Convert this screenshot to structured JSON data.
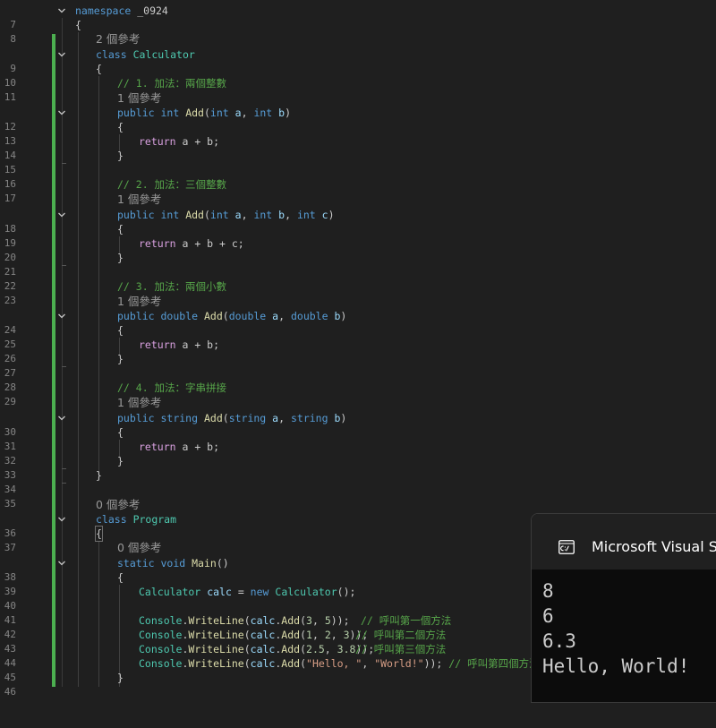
{
  "editor": {
    "line_numbers": [
      "7",
      "8",
      "9",
      "10",
      "11",
      "12",
      "13",
      "14",
      "15",
      "16",
      "17",
      "18",
      "19",
      "20",
      "21",
      "22",
      "23",
      "24",
      "25",
      "26",
      "27",
      "28",
      "29",
      "30",
      "31",
      "32",
      "33",
      "34",
      "35",
      "36",
      "37",
      "38",
      "39",
      "40",
      "41",
      "42",
      "43",
      "44",
      "45",
      "46"
    ],
    "code": {
      "l7_kw": "namespace",
      "l7_name": " _0924",
      "l8": "{",
      "l9_kw": "class",
      "l9_name": "Calculator",
      "l10": "{",
      "l11_cmt": "// 1. 加法：兩個整數",
      "l12_a": "public",
      "l12_b": "int",
      "l12_fn": "Add",
      "l12_c": "(",
      "l12_d": "int",
      "l12_e": "a",
      "l12_f": ", ",
      "l12_g": "int",
      "l12_h": "b",
      "l12_i": ")",
      "l13": "{",
      "l14_ret": "return",
      "l14_expr": " a + b;",
      "l15": "}",
      "l17_cmt": "// 2. 加法：三個整數",
      "l18_a": "public",
      "l18_b": "int",
      "l18_fn": "Add",
      "l18_c": "(",
      "l18_d": "int",
      "l18_e": "a",
      "l18_f": ", ",
      "l18_g": "int",
      "l18_h": "b",
      "l18_i": ", ",
      "l18_j": "int",
      "l18_k": "c",
      "l18_l": ")",
      "l19": "{",
      "l20_ret": "return",
      "l20_expr": " a + b + c;",
      "l21": "}",
      "l23_cmt": "// 3. 加法：兩個小數",
      "l24_a": "public",
      "l24_b": "double",
      "l24_fn": "Add",
      "l24_c": "(",
      "l24_d": "double",
      "l24_e": "a",
      "l24_f": ", ",
      "l24_g": "double",
      "l24_h": "b",
      "l24_i": ")",
      "l25": "{",
      "l26_ret": "return",
      "l26_expr": " a + b;",
      "l27": "}",
      "l29_cmt": "// 4. 加法：字串拼接",
      "l30_a": "public",
      "l30_b": "string",
      "l30_fn": "Add",
      "l30_c": "(",
      "l30_d": "string",
      "l30_e": "a",
      "l30_f": ", ",
      "l30_g": "string",
      "l30_h": "b",
      "l30_i": ")",
      "l31": "{",
      "l32_ret": "return",
      "l32_expr": " a + b;",
      "l33": "}",
      "l34": "}",
      "l36_kw": "class",
      "l36_name": "Program",
      "l37": "{",
      "l38_a": "static",
      "l38_b": "void",
      "l38_fn": "Main",
      "l38_c": "()",
      "l39": "{",
      "l40_type": "Calculator",
      "l40_var": "calc",
      "l40_eq": " = ",
      "l40_new": "new",
      "l40_type2": "Calculator",
      "l40_end": "();",
      "l42_cls": "Console",
      "l42_dot": ".",
      "l42_fn": "WriteLine",
      "l42_p": "(",
      "l42_var": "calc",
      "l42_dot2": ".",
      "l42_fn2": "Add",
      "l42_p2": "(",
      "l42_n1": "3",
      "l42_s": ", ",
      "l42_n2": "5",
      "l42_end": "));",
      "l42_cmt": "// 呼叫第一個方法",
      "l43_cls": "Console",
      "l43_dot": ".",
      "l43_fn": "WriteLine",
      "l43_p": "(",
      "l43_var": "calc",
      "l43_dot2": ".",
      "l43_fn2": "Add",
      "l43_p2": "(",
      "l43_n1": "1",
      "l43_s": ", ",
      "l43_n2": "2",
      "l43_s2": ", ",
      "l43_n3": "3",
      "l43_end": "));",
      "l43_cmt": "// 呼叫第二個方法",
      "l44_cls": "Console",
      "l44_dot": ".",
      "l44_fn": "WriteLine",
      "l44_p": "(",
      "l44_var": "calc",
      "l44_dot2": ".",
      "l44_fn2": "Add",
      "l44_p2": "(",
      "l44_n1": "2.5",
      "l44_s": ", ",
      "l44_n2": "3.8",
      "l44_end": "));",
      "l44_cmt": "// 呼叫第三個方法",
      "l45_cls": "Console",
      "l45_dot": ".",
      "l45_fn": "WriteLine",
      "l45_p": "(",
      "l45_var": "calc",
      "l45_dot2": ".",
      "l45_fn2": "Add",
      "l45_p2": "(",
      "l45_s1": "\"Hello, \"",
      "l45_s": ", ",
      "l45_s2": "\"World!\"",
      "l45_end": "));",
      "l45_cmt": "// 呼叫第四個方法",
      "l46": "}"
    },
    "code_lens": {
      "calculator": "2 個參考",
      "add_1": "1 個參考",
      "add_2": "1 個參考",
      "add_3": "1 個參考",
      "add_4": "1 個參考",
      "program": "0 個參考",
      "main": "0 個參考"
    }
  },
  "console": {
    "title": "Microsoft Visual Studio",
    "output": [
      "8",
      "6",
      "6.3",
      "Hello, World!"
    ]
  }
}
